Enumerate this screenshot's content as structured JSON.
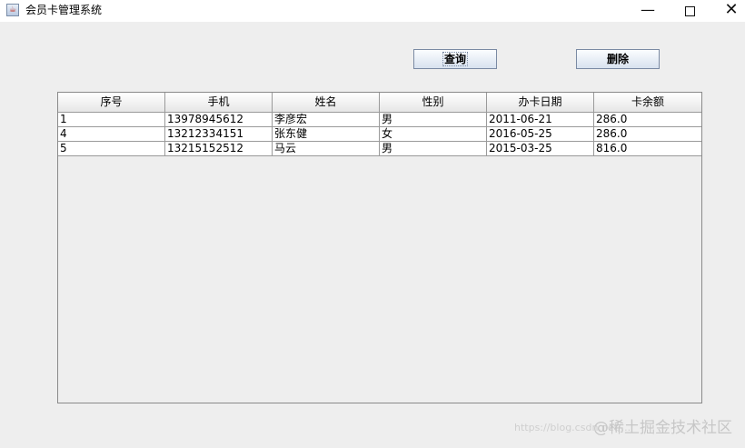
{
  "window": {
    "title": "会员卡管理系统",
    "minimize": "—",
    "close": "✕"
  },
  "toolbar": {
    "query_label": "查询",
    "delete_label": "删除"
  },
  "table": {
    "columns": [
      "序号",
      "手机",
      "姓名",
      "性别",
      "办卡日期",
      "卡余额"
    ],
    "rows": [
      [
        "1",
        "13978945612",
        "李彦宏",
        "男",
        "2011-06-21",
        "286.0"
      ],
      [
        "4",
        "13212334151",
        "张东健",
        "女",
        "2016-05-25",
        "286.0"
      ],
      [
        "5",
        "13215152512",
        "马云",
        "男",
        "2015-03-25",
        "816.0"
      ]
    ]
  },
  "watermark": {
    "text": "@稀土掘金技术社区",
    "url": "https://blog.csdn.net/..."
  }
}
